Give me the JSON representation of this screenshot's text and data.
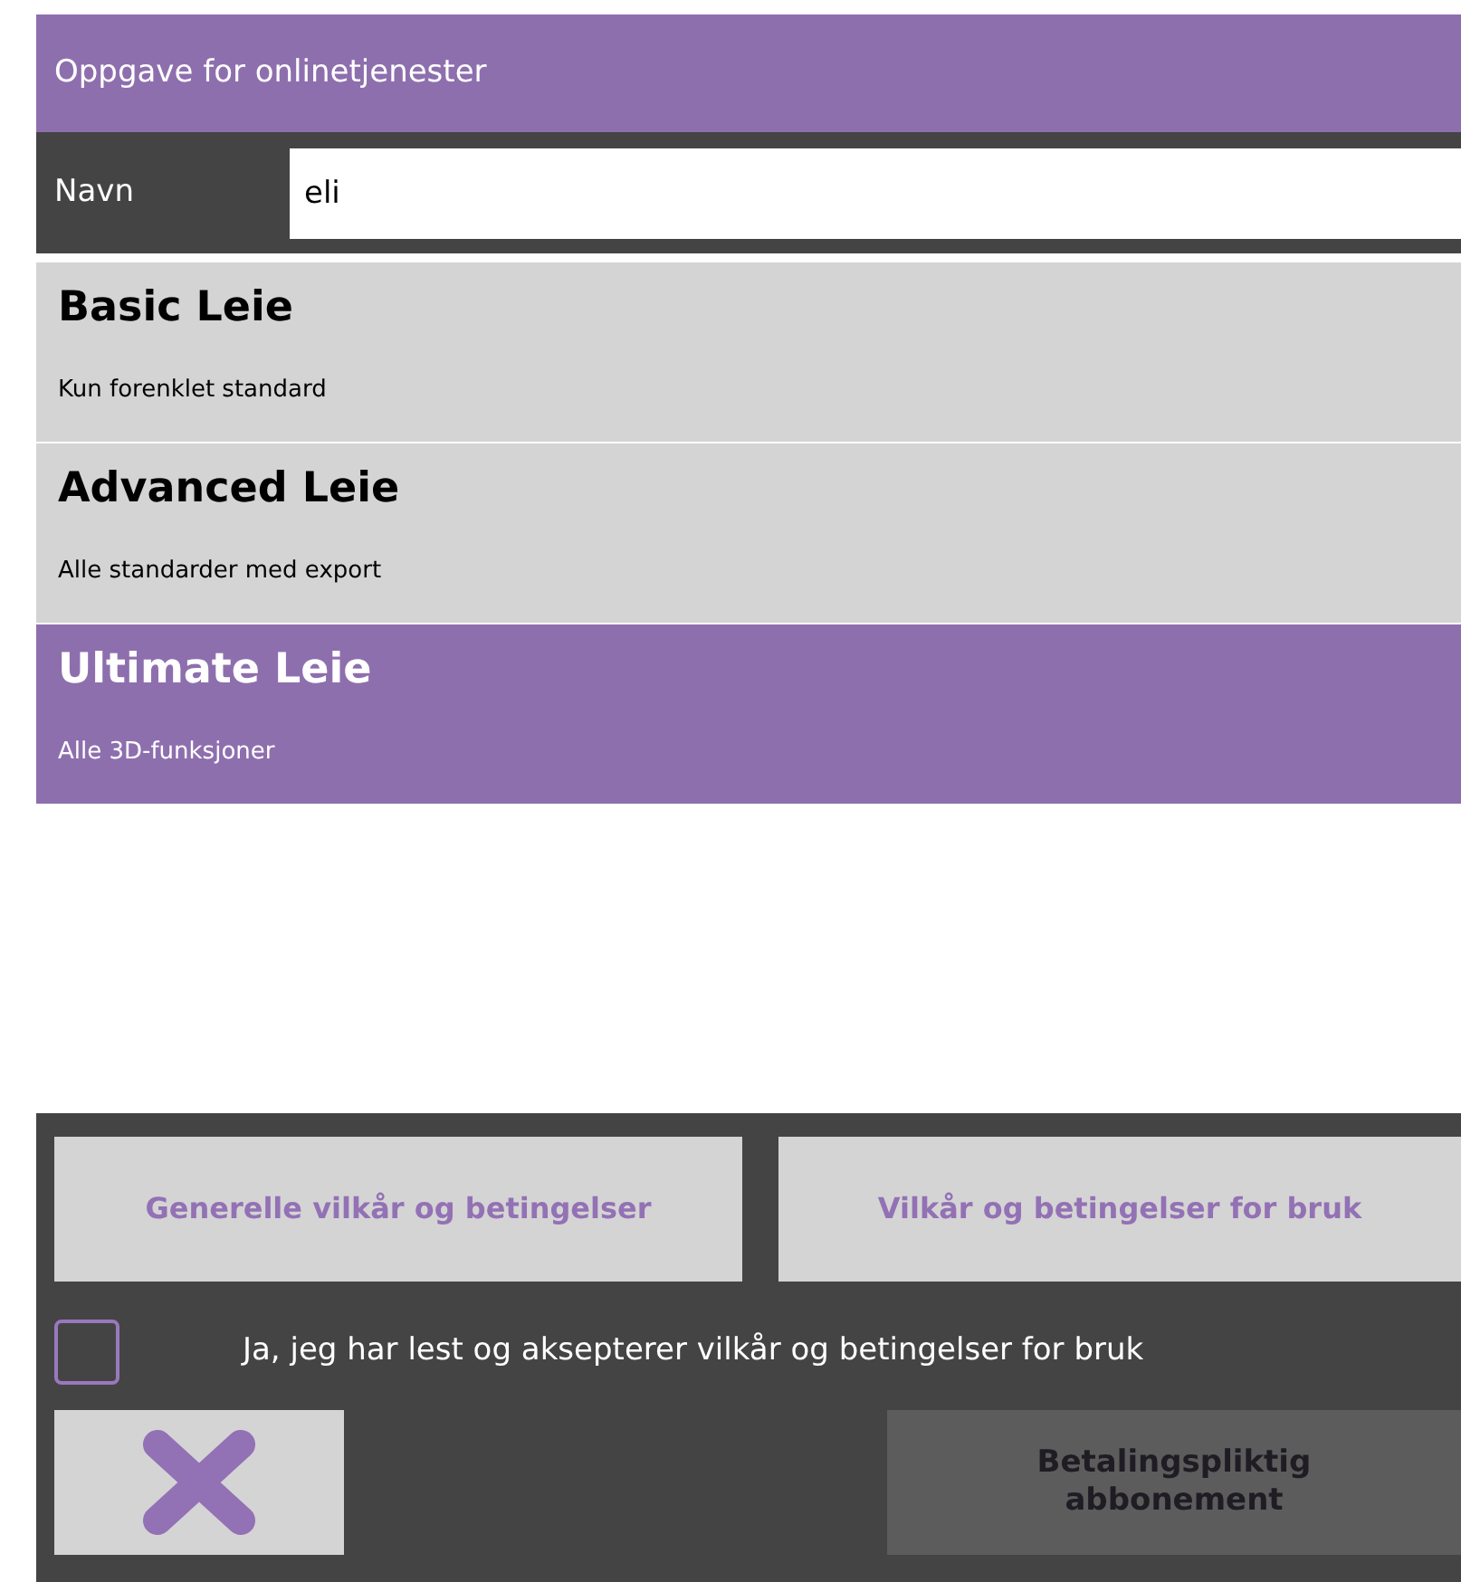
{
  "window": {
    "title": "Oppgave for onlinetjenester"
  },
  "name_field": {
    "label": "Navn",
    "value": "eli"
  },
  "plans": [
    {
      "title": "Basic Leie",
      "description": "Kun forenklet standard",
      "selected": false
    },
    {
      "title": "Advanced Leie",
      "description": "Alle standarder med export",
      "selected": false
    },
    {
      "title": "Ultimate Leie",
      "description": "Alle 3D-funksjoner",
      "selected": true
    }
  ],
  "terms_buttons": [
    "Generelle vilkår og betingelser",
    "Vilkår og betingelser for bruk"
  ],
  "accept": {
    "label": "Ja, jeg har lest og aksepterer vilkår og betingelser for bruk",
    "checked": false
  },
  "subscribe_button": {
    "label": "Betalingspliktig abbonement",
    "disabled": true
  }
}
